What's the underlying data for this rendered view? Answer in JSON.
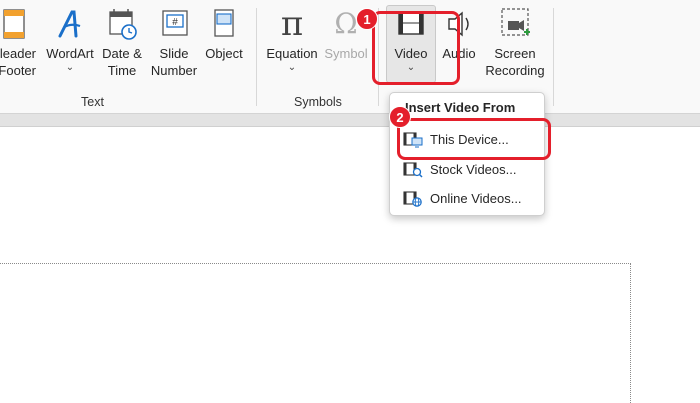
{
  "ribbon": {
    "text_group": {
      "label": "Text",
      "header_footer": {
        "line1": "Header",
        "line2": "Footer",
        "shown1": "leader",
        "shown2": "Footer"
      },
      "wordart": {
        "label": "WordArt",
        "chevron": "⌄"
      },
      "date_time": {
        "line1": "Date &",
        "line2": "Time"
      },
      "slide_number": {
        "line1": "Slide",
        "line2": "Number",
        "glyph": "#"
      },
      "object": {
        "label": "Object"
      }
    },
    "symbols_group": {
      "label": "Symbols",
      "equation": {
        "label": "Equation",
        "chevron": "⌄",
        "glyph": "π"
      },
      "symbol": {
        "label": "Symbol",
        "glyph": "Ω"
      }
    },
    "media_group": {
      "video": {
        "label": "Video",
        "chevron": "⌄"
      },
      "audio": {
        "label": "Audio"
      },
      "screen_recording": {
        "line1": "Screen",
        "line2": "Recording"
      }
    }
  },
  "annotations": {
    "step1": "1",
    "step2": "2",
    "accent_color": "#e41f2b"
  },
  "menu": {
    "title": "Insert Video From",
    "items": [
      {
        "label": "This Device...",
        "icon": "device-video-icon"
      },
      {
        "label": "Stock Videos...",
        "icon": "stock-video-icon"
      },
      {
        "label": "Online Videos...",
        "icon": "online-video-icon"
      }
    ]
  }
}
